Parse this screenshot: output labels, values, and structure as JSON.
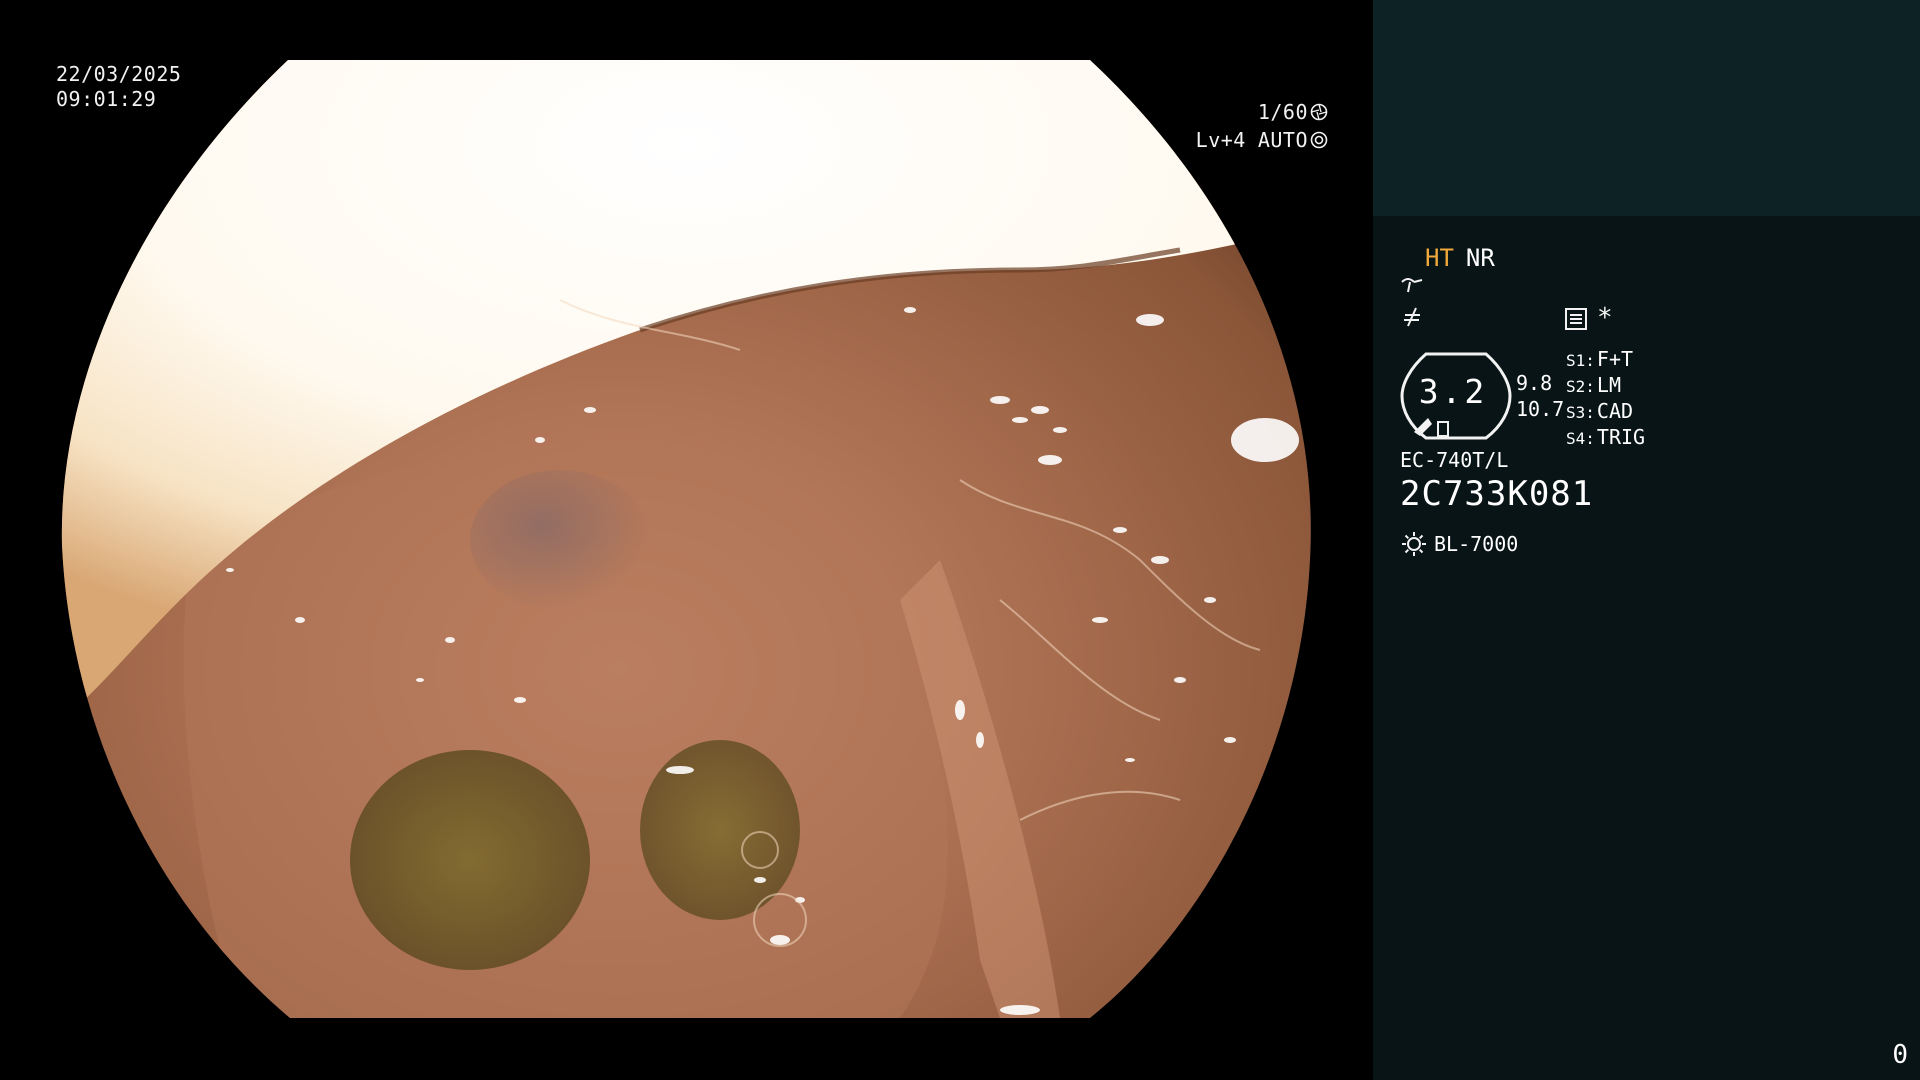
{
  "overlay": {
    "date": "22/03/2025",
    "time": "09:01:29",
    "shutter": "1/60",
    "shutter_icon": "aperture-icon",
    "brightness": "Lv+4",
    "iris_mode": "AUTO",
    "iris_icon": "iris-icon"
  },
  "panel": {
    "mode_ht": "HT",
    "mode_nr": "NR",
    "enhancement_icon": "curve-enhance-icon",
    "filter_icon": "f-slash-icon",
    "settings_icon": "menu-list-icon",
    "star": "*",
    "zoom_value": "3.2",
    "enh_value_1": "9.8",
    "enh_value_2": "10.7",
    "switches": [
      {
        "key": "S1:",
        "value": "F+T"
      },
      {
        "key": "S2:",
        "value": "LM"
      },
      {
        "key": "S3:",
        "value": "CAD"
      },
      {
        "key": "S4:",
        "value": "TRIG"
      }
    ],
    "scope_model": "EC-740T/L",
    "scope_serial": "2C733K081",
    "light_icon": "light-source-icon",
    "light_source": "BL-7000",
    "counter": "0"
  },
  "colors": {
    "panel_bg": "#081416",
    "panel_top_bg": "#0d2224",
    "ht_accent": "#f2a93b",
    "mucosa": "#b87a58"
  }
}
